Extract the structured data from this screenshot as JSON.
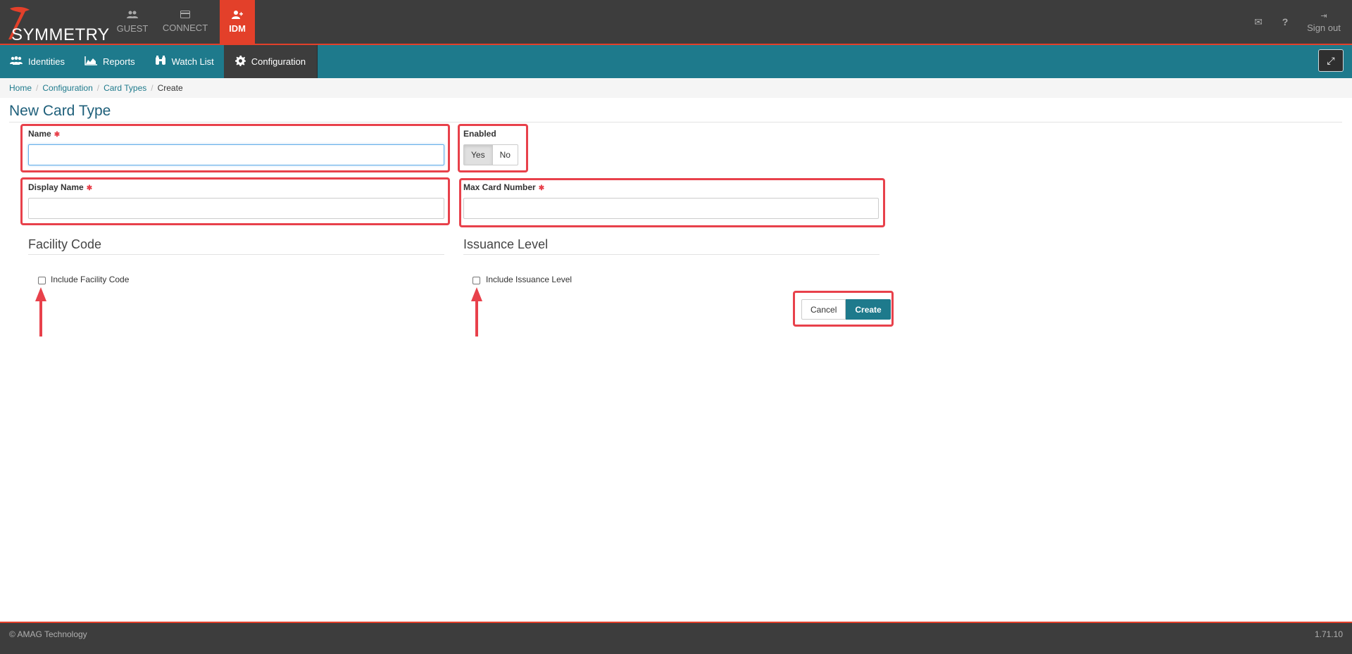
{
  "app": {
    "logo_text": "SYMMETRY",
    "logo_tm": "™",
    "nav": [
      {
        "label": "GUEST",
        "icon": "users-icon"
      },
      {
        "label": "CONNECT",
        "icon": "card-icon"
      },
      {
        "label": "IDM",
        "icon": "user-plus-icon",
        "active": true
      }
    ],
    "header_right": {
      "mail_icon": "✉",
      "help_icon": "?",
      "signout_icon": "⇥",
      "signout_label": "Sign out"
    }
  },
  "module_nav": {
    "items": [
      {
        "label": "Identities",
        "icon": "users-icon"
      },
      {
        "label": "Reports",
        "icon": "area-chart-icon"
      },
      {
        "label": "Watch List",
        "icon": "binoculars-icon"
      },
      {
        "label": "Configuration",
        "icon": "gear-icon",
        "active": true
      }
    ],
    "expand_icon": "⤢"
  },
  "breadcrumb": {
    "items": [
      "Home",
      "Configuration",
      "Card Types"
    ],
    "current": "Create",
    "separator": "/"
  },
  "page": {
    "title": "New Card Type"
  },
  "form": {
    "name_label": "Name",
    "name_value": "",
    "display_name_label": "Display Name",
    "display_name_value": "",
    "enabled_label": "Enabled",
    "enabled_yes": "Yes",
    "enabled_no": "No",
    "enabled_selected": "Yes",
    "max_card_number_label": "Max Card Number",
    "max_card_number_value": "",
    "required_marker": "✱",
    "facility_section_title": "Facility Code",
    "facility_checkbox_label": "Include Facility Code",
    "issuance_section_title": "Issuance Level",
    "issuance_checkbox_label": "Include Issuance Level",
    "cancel_label": "Cancel",
    "create_label": "Create"
  },
  "footer": {
    "copyright": "© AMAG Technology",
    "version": "1.71.10"
  },
  "colors": {
    "topbar": "#3d3d3d",
    "accent_red": "#e3402a",
    "teal": "#1e7a8c",
    "highlight": "#e8414b"
  }
}
